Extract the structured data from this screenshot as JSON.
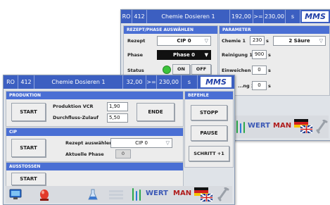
{
  "back": {
    "title": {
      "ro": "RO",
      "num": "412",
      "name": "Chemie Dosieren 1",
      "v1": "192,00",
      "op": ">=",
      "v2": "230,00",
      "unit": "s"
    },
    "brand": "MMS",
    "rezept_panel": {
      "title": "REZEPT/PHASE AUSWÄHLEN",
      "rezept_label": "Rezept",
      "rezept_value": "CIP 0",
      "phase_label": "Phase",
      "phase_value": "Phase 0",
      "status_label": "Status",
      "on": "ON",
      "off": "OFF"
    },
    "param_panel": {
      "title": "PARAMETER",
      "chemie_label": "Chemie 1",
      "chemie_value": "230",
      "chemie_unit": "s",
      "chemie_select": "2 Säure",
      "reinigung_label": "Reinigung 1",
      "reinigung_value": "900",
      "reinigung_unit": "s",
      "einweichen_label": "Einweichen",
      "einweichen_value": "0",
      "einweichen_unit": "s",
      "vorlage_label": "...ng 2",
      "vorlage_value": "0",
      "vorlage_unit": "s"
    },
    "toolbar": {
      "wert": "WERT",
      "man": "MAN"
    }
  },
  "front": {
    "title": {
      "ro": "RO",
      "num": "412",
      "name": "Chemie Dosieren 1",
      "v1": "32,00",
      "op": ">=",
      "v2": "230,00",
      "unit": "s"
    },
    "brand": "MMS",
    "produktion": {
      "title": "PRODUKTION",
      "start": "START",
      "vcr_label": "Produktion VCR",
      "vcr_value": "1,90",
      "flow_label": "Durchfluss-Zulauf",
      "flow_value": "5,50",
      "ende": "ENDE"
    },
    "cip": {
      "title": "CIP",
      "start": "START",
      "rezept_label": "Rezept auswählen",
      "rezept_value": "CIP 0",
      "phase_label": "Aktuelle Phase",
      "phase_value": "0"
    },
    "ausstossen": {
      "title": "AUSSTOSSEN",
      "start": "START"
    },
    "befehle": {
      "title": "BEFEHLE",
      "stopp": "STOPP",
      "pause": "PAUSE",
      "schritt": "SCHRITT +1"
    },
    "toolbar": {
      "wert": "WERT",
      "man": "MAN"
    }
  },
  "colors": {
    "accent": "#3c5fc1",
    "panel_header": "#4a6fd4",
    "status_led": "#3cc43c",
    "brand": "#2240a8",
    "man": "#b01c1c"
  }
}
